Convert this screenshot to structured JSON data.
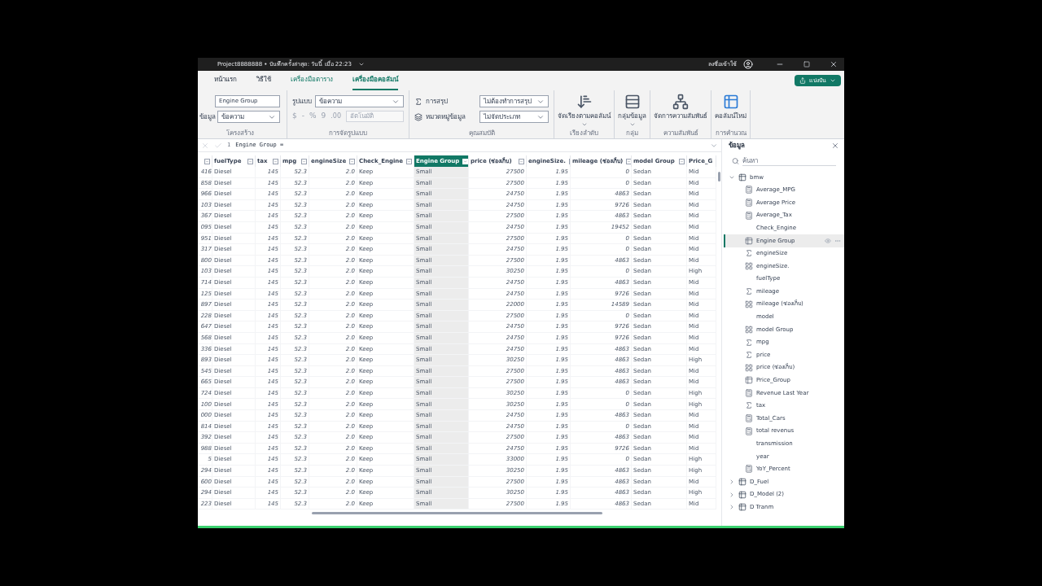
{
  "window": {
    "title": "Project8888888 • บันทึกครั้งล่าสุด: วันนี้ เมื่อ 22:23",
    "sign_in": "ลงชื่อเข้าใช้",
    "share": "แบ่งปัน"
  },
  "tabs": [
    {
      "label": "หน้าแรก",
      "selected": false
    },
    {
      "label": "วิธีใช้",
      "selected": false
    },
    {
      "label": "เครื่องมือตาราง",
      "selected": false
    },
    {
      "label": "เครื่องมือคอลัมน์",
      "selected": true
    }
  ],
  "ribbon": {
    "structure": {
      "name": "Engine Group",
      "data_type_label": "ข้อมูล",
      "data_type": "ข้อความ",
      "group": "โครงสร้าง"
    },
    "formatting": {
      "format_label": "รูปแบบ",
      "format": "ข้อความ",
      "currency": "$",
      "dash": "-",
      "percent": "%",
      "comma": "9",
      "decimals": ".00",
      "auto": "อัตโนมัติ",
      "group": "การจัดรูปแบบ"
    },
    "properties": {
      "summarize_label": "การสรุป",
      "summarize": "ไม่ต้องทำการสรุป",
      "category_label": "หมวดหมู่ข้อมูล",
      "category": "ไม่จัดประเภท",
      "group": "คุณสมบัติ"
    },
    "buttons": [
      {
        "kind": "sort",
        "label": "จัดเรียงตามคอลัมน์",
        "group": "เรียงลำดับ",
        "dropdown": true
      },
      {
        "kind": "groups",
        "label": "กลุ่มข้อมูล",
        "group": "กลุ่ม",
        "dropdown": true
      },
      {
        "kind": "relationships",
        "label": "จัดการความสัมพันธ์",
        "group": "ความสัมพันธ์",
        "dropdown": false
      },
      {
        "kind": "new_column",
        "label": "คอลัมน์ใหม่",
        "group": "การคำนวณ",
        "dropdown": false
      }
    ]
  },
  "formula": {
    "line": "1",
    "text": "Engine Group ="
  },
  "table": {
    "columns": [
      {
        "selected": false
      },
      {
        "label": "fuelType",
        "selected": false
      },
      {
        "label": "tax",
        "selected": false
      },
      {
        "label": "mpg",
        "selected": false
      },
      {
        "label": "engineSize",
        "selected": false
      },
      {
        "label": "Check_Engine",
        "selected": false
      },
      {
        "label": "Engine Group",
        "selected": true
      },
      {
        "label": "price (ช่องเก็บ)",
        "selected": false
      },
      {
        "label": "engineSize.",
        "selected": false
      },
      {
        "label": "mileage (ช่องเก็บ)",
        "selected": false
      },
      {
        "label": "model Group",
        "selected": false
      },
      {
        "label": "Price_G",
        "selected": false
      }
    ],
    "rows": [
      {
        "cells": [
          "416",
          "Diesel",
          "145",
          "52.3",
          "2.0",
          "Keep",
          "Small",
          "27500",
          "1.95",
          "0",
          "Sedan",
          "Mid"
        ]
      },
      {
        "cells": [
          "858",
          "Diesel",
          "145",
          "52.3",
          "2.0",
          "Keep",
          "Small",
          "27500",
          "1.95",
          "0",
          "Sedan",
          "Mid"
        ]
      },
      {
        "cells": [
          "966",
          "Diesel",
          "145",
          "52.3",
          "2.0",
          "Keep",
          "Small",
          "24750",
          "1.95",
          "4863",
          "Sedan",
          "Mid"
        ]
      },
      {
        "cells": [
          "103",
          "Diesel",
          "145",
          "52.3",
          "2.0",
          "Keep",
          "Small",
          "24750",
          "1.95",
          "9726",
          "Sedan",
          "Mid"
        ]
      },
      {
        "cells": [
          "367",
          "Diesel",
          "145",
          "52.3",
          "2.0",
          "Keep",
          "Small",
          "27500",
          "1.95",
          "4863",
          "Sedan",
          "Mid"
        ]
      },
      {
        "cells": [
          "095",
          "Diesel",
          "145",
          "52.3",
          "2.0",
          "Keep",
          "Small",
          "24750",
          "1.95",
          "19452",
          "Sedan",
          "Mid"
        ]
      },
      {
        "cells": [
          "951",
          "Diesel",
          "145",
          "52.3",
          "2.0",
          "Keep",
          "Small",
          "27500",
          "1.95",
          "0",
          "Sedan",
          "Mid"
        ]
      },
      {
        "cells": [
          "317",
          "Diesel",
          "145",
          "52.3",
          "2.0",
          "Keep",
          "Small",
          "24750",
          "1.95",
          "0",
          "Sedan",
          "Mid"
        ]
      },
      {
        "cells": [
          "800",
          "Diesel",
          "145",
          "52.3",
          "2.0",
          "Keep",
          "Small",
          "27500",
          "1.95",
          "4863",
          "Sedan",
          "Mid"
        ]
      },
      {
        "cells": [
          "103",
          "Diesel",
          "145",
          "52.3",
          "2.0",
          "Keep",
          "Small",
          "30250",
          "1.95",
          "0",
          "Sedan",
          "High"
        ]
      },
      {
        "cells": [
          "714",
          "Diesel",
          "145",
          "52.3",
          "2.0",
          "Keep",
          "Small",
          "24750",
          "1.95",
          "4863",
          "Sedan",
          "Mid"
        ]
      },
      {
        "cells": [
          "125",
          "Diesel",
          "145",
          "52.3",
          "2.0",
          "Keep",
          "Small",
          "24750",
          "1.95",
          "9726",
          "Sedan",
          "Mid"
        ]
      },
      {
        "cells": [
          "897",
          "Diesel",
          "145",
          "52.3",
          "2.0",
          "Keep",
          "Small",
          "22000",
          "1.95",
          "14589",
          "Sedan",
          "Mid"
        ]
      },
      {
        "cells": [
          "228",
          "Diesel",
          "145",
          "52.3",
          "2.0",
          "Keep",
          "Small",
          "27500",
          "1.95",
          "0",
          "Sedan",
          "Mid"
        ]
      },
      {
        "cells": [
          "647",
          "Diesel",
          "145",
          "52.3",
          "2.0",
          "Keep",
          "Small",
          "24750",
          "1.95",
          "9726",
          "Sedan",
          "Mid"
        ]
      },
      {
        "cells": [
          "568",
          "Diesel",
          "145",
          "52.3",
          "2.0",
          "Keep",
          "Small",
          "24750",
          "1.95",
          "9726",
          "Sedan",
          "Mid"
        ]
      },
      {
        "cells": [
          "336",
          "Diesel",
          "145",
          "52.3",
          "2.0",
          "Keep",
          "Small",
          "24750",
          "1.95",
          "4863",
          "Sedan",
          "Mid"
        ]
      },
      {
        "cells": [
          "893",
          "Diesel",
          "145",
          "52.3",
          "2.0",
          "Keep",
          "Small",
          "30250",
          "1.95",
          "4863",
          "Sedan",
          "High"
        ]
      },
      {
        "cells": [
          "545",
          "Diesel",
          "145",
          "52.3",
          "2.0",
          "Keep",
          "Small",
          "27500",
          "1.95",
          "4863",
          "Sedan",
          "Mid"
        ]
      },
      {
        "cells": [
          "665",
          "Diesel",
          "145",
          "52.3",
          "2.0",
          "Keep",
          "Small",
          "27500",
          "1.95",
          "4863",
          "Sedan",
          "Mid"
        ]
      },
      {
        "cells": [
          "724",
          "Diesel",
          "145",
          "52.3",
          "2.0",
          "Keep",
          "Small",
          "30250",
          "1.95",
          "0",
          "Sedan",
          "High"
        ]
      },
      {
        "cells": [
          "100",
          "Diesel",
          "145",
          "52.3",
          "2.0",
          "Keep",
          "Small",
          "30250",
          "1.95",
          "0",
          "Sedan",
          "High"
        ]
      },
      {
        "cells": [
          "000",
          "Diesel",
          "145",
          "52.3",
          "2.0",
          "Keep",
          "Small",
          "24750",
          "1.95",
          "4863",
          "Sedan",
          "Mid"
        ]
      },
      {
        "cells": [
          "814",
          "Diesel",
          "145",
          "52.3",
          "2.0",
          "Keep",
          "Small",
          "24750",
          "1.95",
          "0",
          "Sedan",
          "Mid"
        ]
      },
      {
        "cells": [
          "392",
          "Diesel",
          "145",
          "52.3",
          "2.0",
          "Keep",
          "Small",
          "27500",
          "1.95",
          "4863",
          "Sedan",
          "Mid"
        ]
      },
      {
        "cells": [
          "988",
          "Diesel",
          "145",
          "52.3",
          "2.0",
          "Keep",
          "Small",
          "24750",
          "1.95",
          "9726",
          "Sedan",
          "Mid"
        ]
      },
      {
        "cells": [
          "5",
          "Diesel",
          "145",
          "52.3",
          "2.0",
          "Keep",
          "Small",
          "33000",
          "1.95",
          "0",
          "Sedan",
          "High"
        ]
      },
      {
        "cells": [
          "294",
          "Diesel",
          "145",
          "52.3",
          "2.0",
          "Keep",
          "Small",
          "30250",
          "1.95",
          "4863",
          "Sedan",
          "High"
        ]
      },
      {
        "cells": [
          "600",
          "Diesel",
          "145",
          "52.3",
          "2.0",
          "Keep",
          "Small",
          "27500",
          "1.95",
          "4863",
          "Sedan",
          "Mid"
        ]
      },
      {
        "cells": [
          "294",
          "Diesel",
          "145",
          "52.3",
          "2.0",
          "Keep",
          "Small",
          "30250",
          "1.95",
          "4863",
          "Sedan",
          "High"
        ]
      },
      {
        "cells": [
          "223",
          "Diesel",
          "145",
          "52.3",
          "2.0",
          "Keep",
          "Small",
          "27500",
          "1.95",
          "4863",
          "Sedan",
          "Mid"
        ]
      }
    ]
  },
  "data_pane": {
    "title": "ข้อมูล",
    "search": {
      "placeholder": "ค้นหา"
    },
    "tables": [
      {
        "name": "bmw",
        "expanded": true,
        "children": [
          {
            "name": "Average_MPG",
            "kind": "measure",
            "selected": false
          },
          {
            "name": "Average Price",
            "kind": "measure",
            "selected": false
          },
          {
            "name": "Average_Tax",
            "kind": "measure",
            "selected": false
          },
          {
            "name": "Check_Engine",
            "kind": "text",
            "selected": false
          },
          {
            "name": "Engine Group",
            "kind": "calculated",
            "selected": true
          },
          {
            "name": "engineSize",
            "kind": "sum",
            "selected": false
          },
          {
            "name": "engineSize.",
            "kind": "bin",
            "selected": false
          },
          {
            "name": "fuelType",
            "kind": "text",
            "selected": false
          },
          {
            "name": "mileage",
            "kind": "sum",
            "selected": false
          },
          {
            "name": "mileage (ช่องเก็บ)",
            "kind": "bin",
            "selected": false
          },
          {
            "name": "model",
            "kind": "text",
            "selected": false
          },
          {
            "name": "model Group",
            "kind": "bin",
            "selected": false
          },
          {
            "name": "mpg",
            "kind": "sum",
            "selected": false
          },
          {
            "name": "price",
            "kind": "sum",
            "selected": false
          },
          {
            "name": "price (ช่องเก็บ)",
            "kind": "bin",
            "selected": false
          },
          {
            "name": "Price_Group",
            "kind": "calculated",
            "selected": false
          },
          {
            "name": "Revenue Last Year",
            "kind": "measure",
            "selected": false
          },
          {
            "name": "tax",
            "kind": "sum",
            "selected": false
          },
          {
            "name": "Total_Cars",
            "kind": "measure",
            "selected": false
          },
          {
            "name": "total revenus",
            "kind": "measure",
            "selected": false
          },
          {
            "name": "transmission",
            "kind": "text",
            "selected": false
          },
          {
            "name": "year",
            "kind": "text",
            "selected": false
          },
          {
            "name": "YoY_Percent",
            "kind": "measure",
            "selected": false
          }
        ]
      },
      {
        "name": "D_Fuel",
        "expanded": false
      },
      {
        "name": "D_Model (2)",
        "expanded": false
      },
      {
        "name": "D Tranm",
        "expanded": false
      }
    ]
  }
}
